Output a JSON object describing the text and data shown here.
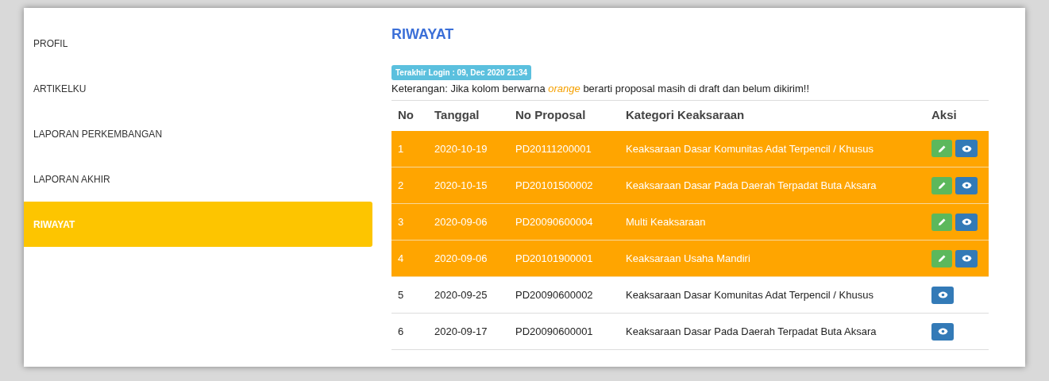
{
  "sidebar": {
    "items": [
      {
        "label": "PROFIL",
        "selected": false
      },
      {
        "label": "ARTIKELKU",
        "selected": false
      },
      {
        "label": "LAPORAN PERKEMBANGAN",
        "selected": false
      },
      {
        "label": "LAPORAN AKHIR",
        "selected": false
      },
      {
        "label": "RIWAYAT",
        "selected": true
      }
    ]
  },
  "main": {
    "title": "RIWAYAT",
    "last_login": "Terakhir Login : 09, Dec 2020 21:34",
    "note": "Keterangan: Jika kolom berwarna *orange* berarti proposal masih di draft dan belum dikirim!!",
    "table": {
      "columns": [
        "No",
        "Tanggal",
        "No Proposal",
        "Kategori Keaksaraan",
        "Aksi"
      ],
      "rows": [
        {
          "no": "1",
          "date": "2020-10-19",
          "proposal": "PD20111200001",
          "category": "Keaksaraan Dasar Komunitas Adat Terpencil / Khusus",
          "draft": true
        },
        {
          "no": "2",
          "date": "2020-10-15",
          "proposal": "PD20101500002",
          "category": "Keaksaraan Dasar Pada Daerah Terpadat Buta Aksara",
          "draft": true
        },
        {
          "no": "3",
          "date": "2020-09-06",
          "proposal": "PD20090600004",
          "category": "Multi Keaksaraan",
          "draft": true
        },
        {
          "no": "4",
          "date": "2020-09-06",
          "proposal": "PD20101900001",
          "category": "Keaksaraan Usaha Mandiri",
          "draft": true
        },
        {
          "no": "5",
          "date": "2020-09-25",
          "proposal": "PD20090600002",
          "category": "Keaksaraan Dasar Komunitas Adat Terpencil / Khusus",
          "draft": false
        },
        {
          "no": "6",
          "date": "2020-09-17",
          "proposal": "PD20090600001",
          "category": "Keaksaraan Dasar Pada Daerah Terpadat Buta Aksara",
          "draft": false
        }
      ]
    }
  }
}
